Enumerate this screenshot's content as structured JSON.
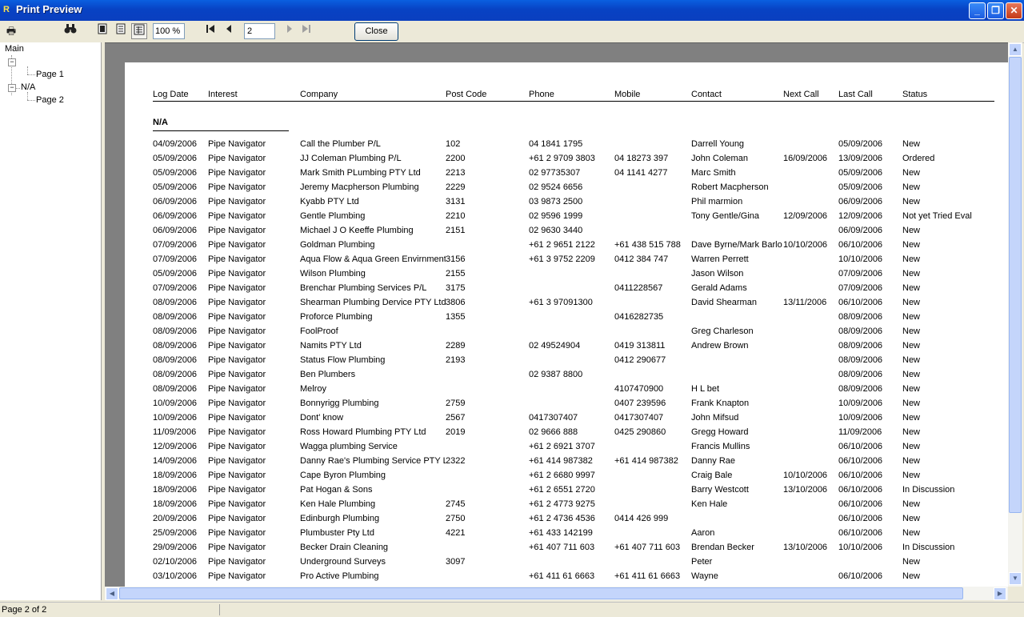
{
  "window": {
    "title": "Print Preview"
  },
  "toolbar": {
    "zoom": "100 %",
    "page": "2",
    "close_label": "Close"
  },
  "tree": {
    "root": "Main",
    "page1": "Page 1",
    "group": "N/A",
    "page2": "Page 2"
  },
  "report": {
    "columns": [
      "Log Date",
      "Interest",
      "Company",
      "Post Code",
      "Phone",
      "Mobile",
      "Contact",
      "Next Call",
      "Last Call",
      "Status"
    ],
    "group": "N/A",
    "rows": [
      [
        "04/09/2006",
        "Pipe Navigator",
        "Call the Plumber P/L",
        "102",
        "04 1841 1795",
        "",
        "Darrell Young",
        "",
        "05/09/2006",
        "New"
      ],
      [
        "05/09/2006",
        "Pipe Navigator",
        "JJ Coleman Plumbing P/L",
        "2200",
        "+61 2 9709 3803",
        "04 18273 397",
        "John Coleman",
        "16/09/2006",
        "13/09/2006",
        "Ordered"
      ],
      [
        "05/09/2006",
        "Pipe Navigator",
        "Mark Smith PLumbing PTY Ltd",
        "2213",
        "02 97735307",
        "04 1141 4277",
        "Marc Smith",
        "",
        "05/09/2006",
        "New"
      ],
      [
        "05/09/2006",
        "Pipe Navigator",
        "Jeremy Macpherson Plumbing",
        "2229",
        "02 9524 6656",
        "",
        "Robert Macpherson",
        "",
        "05/09/2006",
        "New"
      ],
      [
        "06/09/2006",
        "Pipe Navigator",
        "Kyabb PTY Ltd",
        "3131",
        "03 9873 2500",
        "",
        "Phil marmion",
        "",
        "06/09/2006",
        "New"
      ],
      [
        "06/09/2006",
        "Pipe Navigator",
        "Gentle Plumbing",
        "2210",
        "02 9596 1999",
        "",
        "Tony Gentle/Gina",
        "12/09/2006",
        "12/09/2006",
        "Not yet Tried Eval"
      ],
      [
        "06/09/2006",
        "Pipe Navigator",
        "Michael J O Keeffe Plumbing",
        "2151",
        "02 9630 3440",
        "",
        "",
        "",
        "06/09/2006",
        "New"
      ],
      [
        "07/09/2006",
        "Pipe Navigator",
        "Goldman Plumbing",
        "",
        "+61 2 9651 2122",
        "+61 438 515 788",
        "Dave Byrne/Mark Barlo",
        "10/10/2006",
        "06/10/2006",
        "New"
      ],
      [
        "07/09/2006",
        "Pipe Navigator",
        "Aqua Flow & Aqua Green Envirnment",
        "3156",
        "+61 3  9752 2209",
        "0412 384 747",
        "Warren Perrett",
        "",
        "10/10/2006",
        "New"
      ],
      [
        "05/09/2006",
        "Pipe Navigator",
        "Wilson Plumbing",
        "2155",
        "",
        "",
        "Jason Wilson",
        "",
        "07/09/2006",
        "New"
      ],
      [
        "07/09/2006",
        "Pipe Navigator",
        "Brenchar Plumbing Services P/L",
        "3175",
        "",
        "0411228567",
        "Gerald Adams",
        "",
        "07/09/2006",
        "New"
      ],
      [
        "08/09/2006",
        "Pipe Navigator",
        "Shearman Plumbing Dervice PTY Ltd",
        "3806",
        "+61 3 97091300",
        "",
        "David Shearman",
        "13/11/2006",
        "06/10/2006",
        "New"
      ],
      [
        "08/09/2006",
        "Pipe Navigator",
        "Proforce Plumbing",
        "1355",
        "",
        "0416282735",
        "",
        "",
        "08/09/2006",
        "New"
      ],
      [
        "08/09/2006",
        "Pipe Navigator",
        "FoolProof",
        "",
        "",
        "",
        "Greg Charleson",
        "",
        "08/09/2006",
        "New"
      ],
      [
        "08/09/2006",
        "Pipe Navigator",
        "Namits PTY Ltd",
        "2289",
        "02 49524904",
        "0419 313811",
        "Andrew Brown",
        "",
        "08/09/2006",
        "New"
      ],
      [
        "08/09/2006",
        "Pipe Navigator",
        "Status Flow Plumbing",
        "2193",
        "",
        "0412 290677",
        "",
        "",
        "08/09/2006",
        "New"
      ],
      [
        "08/09/2006",
        "Pipe Navigator",
        "Ben Plumbers",
        "",
        "02 9387 8800",
        "",
        "",
        "",
        "08/09/2006",
        "New"
      ],
      [
        "08/09/2006",
        "Pipe Navigator",
        "Melroy",
        "",
        "",
        "4107470900",
        "H L bet",
        "",
        "08/09/2006",
        "New"
      ],
      [
        "10/09/2006",
        "Pipe Navigator",
        "Bonnyrigg Plumbing",
        "2759",
        "",
        "0407 239596",
        "Frank Knapton",
        "",
        "10/09/2006",
        "New"
      ],
      [
        "10/09/2006",
        "Pipe Navigator",
        "Dont' know",
        "2567",
        "0417307407",
        "0417307407",
        "John Mifsud",
        "",
        "10/09/2006",
        "New"
      ],
      [
        "11/09/2006",
        "Pipe Navigator",
        "Ross Howard Plumbing PTY Ltd",
        "2019",
        "02 9666 888",
        "0425 290860",
        "Gregg Howard",
        "",
        "11/09/2006",
        "New"
      ],
      [
        "12/09/2006",
        "Pipe Navigator",
        "Wagga plumbing Service",
        "",
        "+61 2 6921 3707",
        "",
        "Francis Mullins",
        "",
        "06/10/2006",
        "New"
      ],
      [
        "14/09/2006",
        "Pipe Navigator",
        "Danny Rae's Plumbing Service PTY Ltd",
        "2322",
        "+61 414 987382",
        "+61 414 987382",
        "Danny Rae",
        "",
        "06/10/2006",
        "New"
      ],
      [
        "18/09/2006",
        "Pipe Navigator",
        "Cape Byron Plumbing",
        "",
        "+61 2 6680 9997",
        "",
        "Craig Bale",
        "10/10/2006",
        "06/10/2006",
        "New"
      ],
      [
        "18/09/2006",
        "Pipe Navigator",
        "Pat Hogan & Sons",
        "",
        "+61 2 6551 2720",
        "",
        "Barry Westcott",
        "13/10/2006",
        "06/10/2006",
        "In Discussion"
      ],
      [
        "18/09/2006",
        "Pipe Navigator",
        "Ken Hale Plumbing",
        "2745",
        "+61 2 4773 9275",
        "",
        "Ken Hale",
        "",
        "06/10/2006",
        "New"
      ],
      [
        "20/09/2006",
        "Pipe Navigator",
        "Edinburgh Plumbing",
        "2750",
        "+61 2 4736 4536",
        "0414 426 999",
        "",
        "",
        "06/10/2006",
        "New"
      ],
      [
        "25/09/2006",
        "Pipe Navigator",
        "Plumbuster Pty Ltd",
        "4221",
        "+61 433 142199",
        "",
        "Aaron",
        "",
        "06/10/2006",
        "New"
      ],
      [
        "29/09/2006",
        "Pipe Navigator",
        "Becker Drain Cleaning",
        "",
        "+61 407 711 603",
        "+61 407 711 603",
        "Brendan Becker",
        "13/10/2006",
        "10/10/2006",
        "In Discussion"
      ],
      [
        "02/10/2006",
        "Pipe Navigator",
        "Underground Surveys",
        "3097",
        "",
        "",
        "Peter",
        "",
        "",
        "New"
      ],
      [
        "03/10/2006",
        "Pipe Navigator",
        "Pro Active Plumbing",
        "",
        "+61 411 61 6663",
        "+61 411 61 6663",
        "Wayne",
        "",
        "06/10/2006",
        "New"
      ]
    ]
  },
  "status": {
    "text": "Page 2 of 2"
  }
}
